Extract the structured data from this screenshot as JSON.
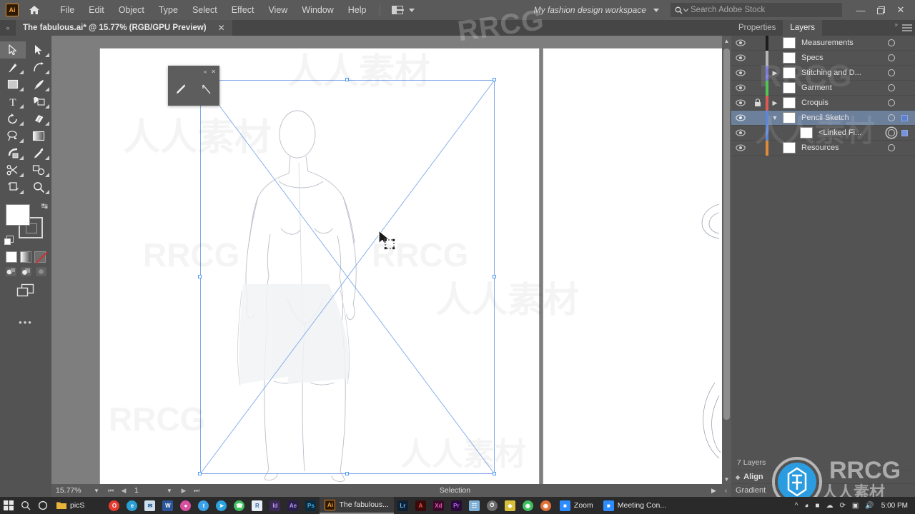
{
  "app": {
    "name": "Adobe Illustrator",
    "logo_text": "Ai",
    "home_icon": "home-icon"
  },
  "menubar": {
    "items": [
      "File",
      "Edit",
      "Object",
      "Type",
      "Select",
      "Effect",
      "View",
      "Window",
      "Help"
    ],
    "arrange_icon": "arrange-documents-icon",
    "arrange_caret": "chevron-down-icon",
    "workspace": "My fashion design workspace",
    "workspace_caret": "chevron-down-icon",
    "search": {
      "icon": "search-icon",
      "caret": "chevron-down-icon",
      "placeholder": "Search Adobe Stock",
      "value": ""
    },
    "window_controls": {
      "minimize": "—",
      "restore": "❐",
      "close": "✕"
    }
  },
  "tabbar": {
    "collapse_icon": "collapse-left-icon",
    "document": {
      "title": "The fabulous.ai* @ 15.77% (RGB/GPU Preview)",
      "close": "✕"
    }
  },
  "toolbar": {
    "tools": [
      {
        "name": "selection-tool",
        "label": "Selection",
        "active": true,
        "flyout": false
      },
      {
        "name": "direct-selection-tool",
        "label": "Direct Selection",
        "active": false,
        "flyout": true
      },
      {
        "name": "pen-tool",
        "label": "Pen",
        "active": false,
        "flyout": true
      },
      {
        "name": "curvature-tool",
        "label": "Curvature",
        "active": false,
        "flyout": true
      },
      {
        "name": "rectangle-tool",
        "label": "Rectangle",
        "active": false,
        "flyout": true
      },
      {
        "name": "paintbrush-tool",
        "label": "Paintbrush",
        "active": false,
        "flyout": true
      },
      {
        "name": "type-tool",
        "label": "Type",
        "active": false,
        "flyout": true
      },
      {
        "name": "shape-builder-tool",
        "label": "Shape Builder",
        "active": false,
        "flyout": true
      },
      {
        "name": "rotate-tool",
        "label": "Rotate",
        "active": false,
        "flyout": true
      },
      {
        "name": "eraser-tool",
        "label": "Eraser",
        "active": false,
        "flyout": true
      },
      {
        "name": "lasso-tool",
        "label": "Lasso",
        "active": false,
        "flyout": true
      },
      {
        "name": "gradient-tool",
        "label": "Gradient",
        "active": false,
        "flyout": false
      },
      {
        "name": "width-tool",
        "label": "Width",
        "active": false,
        "flyout": true
      },
      {
        "name": "eyedropper-tool",
        "label": "Eyedropper",
        "active": false,
        "flyout": true
      },
      {
        "name": "scissors-tool",
        "label": "Scissors",
        "active": false,
        "flyout": true
      },
      {
        "name": "blend-tool",
        "label": "Blend",
        "active": false,
        "flyout": true
      },
      {
        "name": "artboard-tool",
        "label": "Artboard",
        "active": false,
        "flyout": true
      },
      {
        "name": "zoom-tool",
        "label": "Zoom",
        "active": false,
        "flyout": true
      }
    ],
    "fill_color": "#ffffff",
    "stroke_color": "none",
    "swap_icon": "swap-fill-stroke-icon",
    "default_icon": "default-fill-stroke-icon",
    "color_modes": [
      "color-swatch",
      "gradient-swatch",
      "none-swatch"
    ],
    "draw_modes": [
      "draw-normal",
      "draw-behind",
      "draw-inside"
    ],
    "screen_mode_icon": "screen-mode-icon",
    "more_tools": "•••"
  },
  "canvas": {
    "float_panel": {
      "collapse": "«",
      "close": "✕",
      "tools": [
        {
          "name": "pencil-tool",
          "label": "Pencil"
        },
        {
          "name": "line-segment-tool",
          "label": "Line Segment"
        }
      ]
    },
    "cursor": "selection-cursor-with-move-icon",
    "placed_image": {
      "name": "linked-placed-image-bounds",
      "selected": true
    },
    "artboards": 2
  },
  "statusbar": {
    "zoom": "15.77%",
    "zoom_caret": "chevron-down-icon",
    "nav_first": "first-artboard-icon",
    "nav_prev": "previous-artboard-icon",
    "page": "1",
    "page_caret": "chevron-down-icon",
    "nav_next": "next-artboard-icon",
    "nav_last": "last-artboard-icon",
    "tool_label": "Selection",
    "play": "status-play-icon",
    "more": "status-more-icon"
  },
  "layers_panel": {
    "tabs": [
      {
        "name": "tab-properties",
        "label": "Properties",
        "active": false
      },
      {
        "name": "tab-layers",
        "label": "Layers",
        "active": true
      }
    ],
    "collapse_icon": "collapse-panel-icon",
    "menu_icon": "panel-menu-icon",
    "layers": [
      {
        "name": "Measurements",
        "color": "#1c1c1c",
        "visible": true,
        "locked": false,
        "expandable": false,
        "expanded": false,
        "child": false,
        "selected": false,
        "target_double": false,
        "has_selection": false
      },
      {
        "name": "Specs",
        "color": "#b7b7b7",
        "visible": true,
        "locked": false,
        "expandable": false,
        "expanded": false,
        "child": false,
        "selected": false,
        "target_double": false,
        "has_selection": false
      },
      {
        "name": "Stitching and D...",
        "color": "#7b7bd9",
        "visible": true,
        "locked": false,
        "expandable": true,
        "expanded": false,
        "child": false,
        "selected": false,
        "target_double": false,
        "has_selection": false
      },
      {
        "name": "Garment",
        "color": "#52c552",
        "visible": true,
        "locked": false,
        "expandable": false,
        "expanded": false,
        "child": false,
        "selected": false,
        "target_double": false,
        "has_selection": false
      },
      {
        "name": "Croquis",
        "color": "#e05a55",
        "visible": true,
        "locked": true,
        "expandable": true,
        "expanded": false,
        "child": false,
        "selected": false,
        "target_double": false,
        "has_selection": false
      },
      {
        "name": "Pencil Sketch",
        "color": "#5c86d6",
        "visible": true,
        "locked": false,
        "expandable": true,
        "expanded": true,
        "child": false,
        "selected": true,
        "target_double": false,
        "has_selection": true
      },
      {
        "name": "<Linked Fi...",
        "color": "#5c86d6",
        "visible": true,
        "locked": false,
        "expandable": false,
        "expanded": false,
        "child": true,
        "selected": false,
        "target_double": true,
        "has_selection": true
      },
      {
        "name": "Resources",
        "color": "#e08a3c",
        "visible": true,
        "locked": false,
        "expandable": false,
        "expanded": false,
        "child": false,
        "selected": false,
        "target_double": false,
        "has_selection": false
      }
    ],
    "count_label": "7 Layers",
    "collapsed_panels": [
      {
        "name": "panel-align",
        "label": "Align"
      },
      {
        "name": "panel-gradient",
        "label": "Gradient"
      }
    ]
  },
  "taskbar": {
    "start_icon": "windows-start-icon",
    "search_icon": "search-icon",
    "cortana_icon": "cortana-icon",
    "folder": {
      "icon": "folder-icon",
      "label": "picS"
    },
    "pinned": [
      {
        "name": "opera-icon",
        "color": "#e63b2e",
        "glyph": "O"
      },
      {
        "name": "edge-icon",
        "color": "#2a9fd6",
        "glyph": "e"
      },
      {
        "name": "mail-icon",
        "color": "#b9cfe0",
        "glyph": "✉"
      },
      {
        "name": "word-icon",
        "color": "#2b579a",
        "glyph": "W"
      },
      {
        "name": "messenger-icon",
        "color": "#d94fa0",
        "glyph": "●"
      },
      {
        "name": "twitter-icon",
        "color": "#3aa0e8",
        "glyph": "t"
      },
      {
        "name": "telegram-icon",
        "color": "#2aa3de",
        "glyph": "➤"
      },
      {
        "name": "whatsapp-icon",
        "color": "#3fbf5f",
        "glyph": "☎"
      },
      {
        "name": "bridge-icon",
        "color": "#3a6ea5",
        "glyph": "R"
      },
      {
        "name": "indesign-icon",
        "color": "#6a2fa0",
        "glyph": "Id"
      },
      {
        "name": "aftereffects-icon",
        "color": "#5b3fb5",
        "glyph": "Ae"
      },
      {
        "name": "photoshop-icon",
        "color": "#1b6aa5",
        "glyph": "Ps"
      }
    ],
    "apps": [
      {
        "name": "taskbar-app-illustrator",
        "icon_color": "#e08020",
        "glyph": "Ai",
        "label": "The fabulous...",
        "active": true
      },
      {
        "name": "taskbar-app-lightroom",
        "icon_color": "#3a6ea5",
        "glyph": "Lr",
        "label": "",
        "active": false
      },
      {
        "name": "taskbar-app-acrobat",
        "icon_color": "#b0281a",
        "glyph": "A",
        "label": "",
        "active": false
      },
      {
        "name": "taskbar-app-xd",
        "icon_color": "#c0308a",
        "glyph": "Xd",
        "label": "",
        "active": false
      },
      {
        "name": "taskbar-app-premiere",
        "icon_color": "#7a3fb0",
        "glyph": "Pr",
        "label": "",
        "active": false
      },
      {
        "name": "taskbar-app-explorer",
        "icon_color": "#6fa8d0",
        "glyph": "◧",
        "label": "",
        "active": false
      },
      {
        "name": "taskbar-app-clock",
        "icon_color": "#7d7d7d",
        "glyph": "◷",
        "label": "",
        "active": false
      },
      {
        "name": "taskbar-app-note",
        "icon_color": "#d8c03a",
        "glyph": "◆",
        "label": "",
        "active": false
      },
      {
        "name": "taskbar-app-chrome",
        "icon_color": "#3fbf5f",
        "glyph": "◎",
        "label": "",
        "active": false
      },
      {
        "name": "taskbar-app-firefox",
        "icon_color": "#e0703a",
        "glyph": "◉",
        "label": "",
        "active": false
      },
      {
        "name": "taskbar-app-zoom",
        "icon_color": "#2d8cff",
        "glyph": "■",
        "label": "Zoom",
        "active": false
      },
      {
        "name": "taskbar-app-meeting",
        "icon_color": "#2d8cff",
        "glyph": "■",
        "label": "Meeting Con...",
        "active": false
      }
    ],
    "tray": {
      "chevron": "show-hidden-icons",
      "icons": [
        "wifi-icon",
        "battery-icon",
        "onedrive-icon",
        "sync-icon",
        "camera-icon",
        "volume-icon"
      ],
      "time": "5:00 PM",
      "date": ""
    }
  },
  "watermarks": {
    "rrcg": "RRCG",
    "cn": "人人素材"
  }
}
